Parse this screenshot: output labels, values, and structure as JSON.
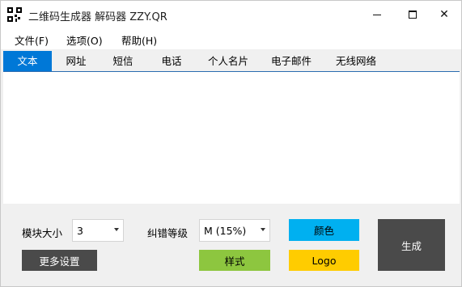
{
  "window": {
    "title": "二维码生成器 解码器 ZZY.QR",
    "close_glyph": "✕"
  },
  "menu": [
    "文件(F)",
    "选项(O)",
    "帮助(H)"
  ],
  "tabs": [
    {
      "label": "文本",
      "active": true
    },
    {
      "label": "网址"
    },
    {
      "label": "短信"
    },
    {
      "label": "电话"
    },
    {
      "label": "个人名片"
    },
    {
      "label": "电子邮件"
    },
    {
      "label": "无线网络"
    }
  ],
  "content": {
    "text": ""
  },
  "controls": {
    "module_size_label": "模块大小",
    "module_size_value": "3",
    "ecc_label": "纠错等级",
    "ecc_value": "M (15%)",
    "more_settings_label": "更多设置",
    "style_label": "样式",
    "color_label": "颜色",
    "logo_label": "Logo",
    "generate_label": "生成"
  },
  "colors": {
    "accent": "#0078d7",
    "more_settings_bg": "#4a4a4a",
    "style_bg": "#8dc63f",
    "color_bg": "#00b0f0",
    "logo_bg": "#ffcc00",
    "generate_bg": "#4a4a4a"
  },
  "icons": {
    "app": "qr-code-icon",
    "dropdown": "chevron-down-icon"
  }
}
